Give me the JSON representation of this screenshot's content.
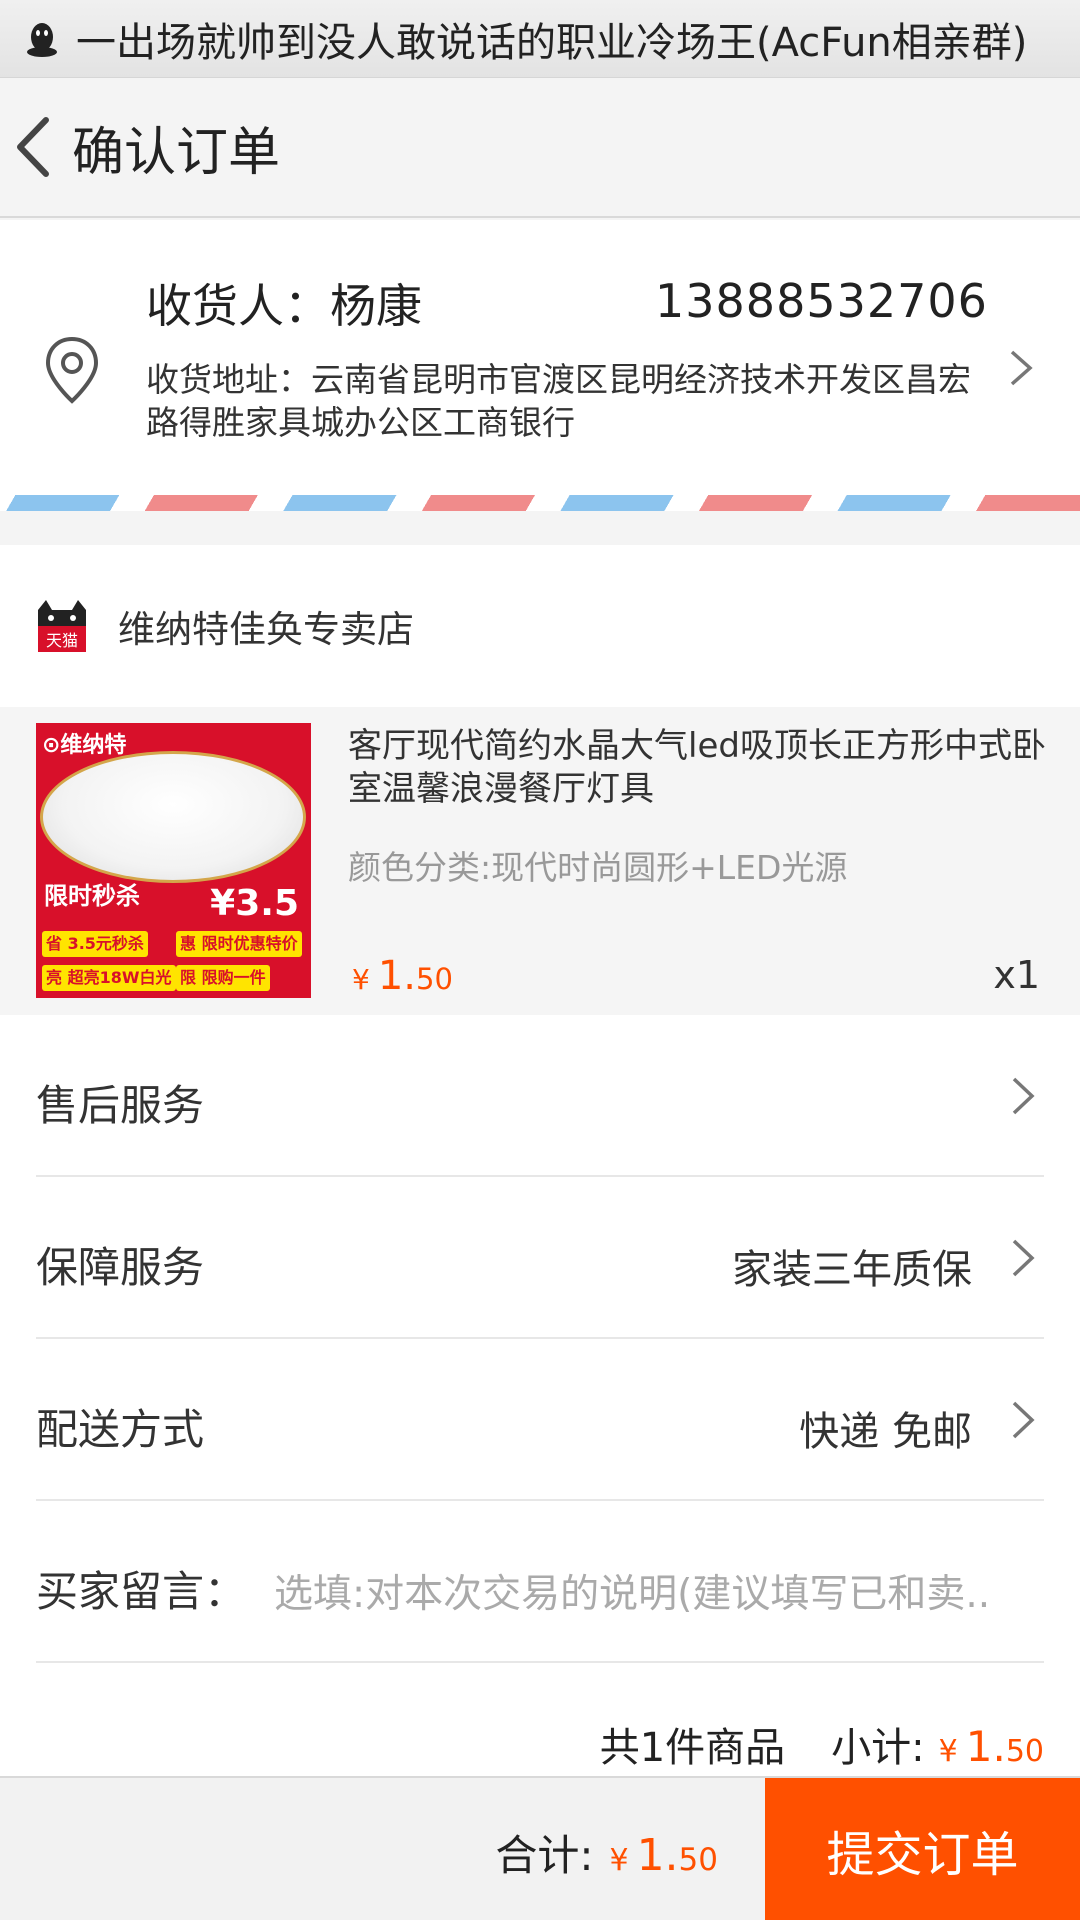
{
  "notification": {
    "text": "一出场就帅到没人敢说话的职业冷场王(AcFun相亲群)",
    "icon": "qq-penguin-icon"
  },
  "header": {
    "title": "确认订单",
    "back_icon": "chevron-left-icon"
  },
  "address": {
    "receiver": "收货人：杨康",
    "phone": "13888532706",
    "detail": "收货地址：云南省昆明市官渡区昆明经济技术开发区昌宏路得胜家具城办公区工商银行"
  },
  "shop": {
    "name": "维纳特佳奂专卖店",
    "logo_text": "天猫"
  },
  "product": {
    "title": "客厅现代简约水晶大气led吸顶长正方形中式卧室温馨浪漫餐厅灯具",
    "spec": "颜色分类:现代时尚圆形+LED光源",
    "price_symbol": "¥",
    "price_int": "1.",
    "price_dec": "50",
    "qty": "x1",
    "thumb": {
      "brand": "⊙维纳特",
      "promo": "限时秒杀",
      "price": "¥3.5",
      "tags": [
        "省 3.5元秒杀",
        "惠 限时优惠特价",
        "亮 超亮18W白光",
        "限 限购一件"
      ]
    }
  },
  "rows": {
    "after_sale": {
      "label": "售后服务"
    },
    "guarantee": {
      "label": "保障服务",
      "value": "家装三年质保"
    },
    "delivery": {
      "label": "配送方式",
      "value": "快递 免邮"
    },
    "message": {
      "label": "买家留言：",
      "placeholder": "选填:对本次交易的说明(建议填写已和卖.."
    }
  },
  "subtotal": {
    "count": "共1件商品",
    "label": "小计:",
    "symbol": "¥",
    "int": "1.",
    "dec": "50"
  },
  "bottom": {
    "total_label": "合计:",
    "symbol": "¥",
    "int": "1.",
    "dec": "50",
    "submit": "提交订单"
  },
  "colors": {
    "accent": "#ff5000",
    "stripe_red": "#f08b8b",
    "stripe_blue": "#8cc4ee"
  }
}
